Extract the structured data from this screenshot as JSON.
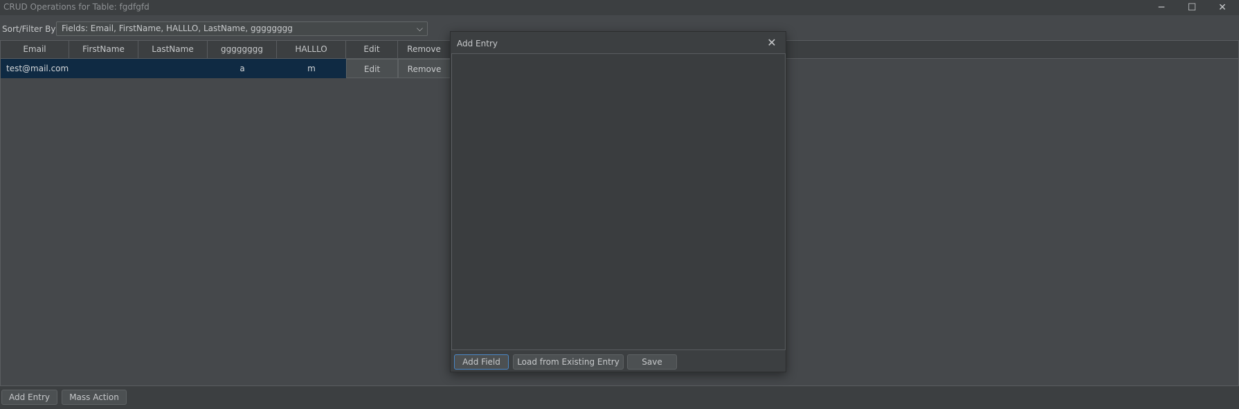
{
  "window": {
    "title": "CRUD Operations for Table: fgdfgfd",
    "minimize_glyph": "─",
    "maximize_glyph": "☐",
    "close_glyph": "✕"
  },
  "filter": {
    "label": "Sort/Filter By:",
    "selected": "Fields: Email, FirstName, HALLLO, LastName, gggggggg",
    "arrow_glyph": "⌵"
  },
  "table": {
    "columns": [
      "Email",
      "FirstName",
      "LastName",
      "gggggggg",
      "HALLLO",
      "Edit",
      "Remove"
    ],
    "rows": [
      {
        "email": "test@mail.com",
        "firstname": "",
        "lastname": "",
        "gggggggg": "a",
        "halllo": "m",
        "edit": "Edit",
        "remove": "Remove"
      }
    ]
  },
  "bottom": {
    "add_entry": "Add Entry",
    "mass_action": "Mass Action"
  },
  "dialog": {
    "title": "Add Entry",
    "close_glyph": "✕",
    "add_field": "Add Field",
    "load_existing": "Load from Existing Entry",
    "save": "Save"
  },
  "colors": {
    "background": "#45484b",
    "titlebar": "#3c3f41",
    "selection": "#0f2a43",
    "focus_border": "#4a88c7"
  }
}
